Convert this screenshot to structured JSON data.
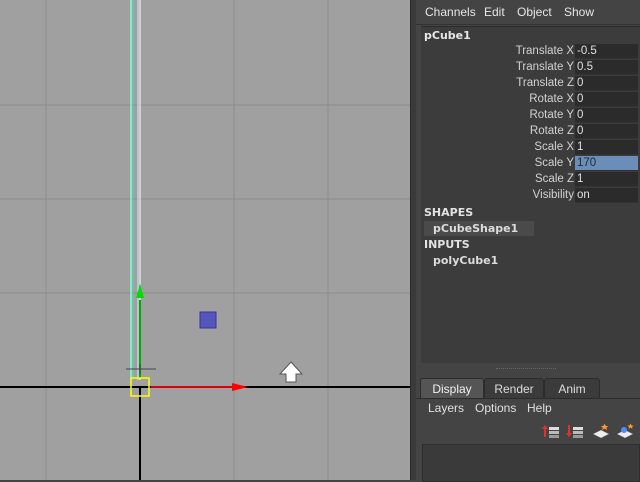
{
  "channel_menu": [
    "Channels",
    "Edit",
    "Object",
    "Show"
  ],
  "node": "pCube1",
  "attributes": [
    {
      "label": "Translate X",
      "value": "-0.5"
    },
    {
      "label": "Translate Y",
      "value": "0.5"
    },
    {
      "label": "Translate Z",
      "value": "0"
    },
    {
      "label": "Rotate X",
      "value": "0"
    },
    {
      "label": "Rotate Y",
      "value": "0"
    },
    {
      "label": "Rotate Z",
      "value": "0"
    },
    {
      "label": "Scale X",
      "value": "1"
    },
    {
      "label": "Scale Y",
      "value": "170"
    },
    {
      "label": "Scale Z",
      "value": "1"
    },
    {
      "label": "Visibility",
      "value": "on"
    }
  ],
  "selected_attribute": "Scale Y",
  "shapes": {
    "heading": "SHAPES",
    "item": "pCubeShape1"
  },
  "inputs": {
    "heading": "INPUTS",
    "item": "polyCube1"
  },
  "layer_tabs": [
    "Display",
    "Render",
    "Anim"
  ],
  "active_tab": "Display",
  "layer_menu": [
    "Layers",
    "Options",
    "Help"
  ],
  "layer_icons": [
    "move-layer-up-icon",
    "move-layer-down-icon",
    "new-layer-icon",
    "new-layer-from-selection-icon"
  ],
  "colors": {
    "viewport_bg": "#a0a0a0",
    "grid": "#8a8a8a",
    "axis": "#000000",
    "selected_wire": "#7fffd4",
    "manip_x": "#ff0000",
    "manip_y": "#00cc00",
    "highlight": "#6a8eb8"
  }
}
